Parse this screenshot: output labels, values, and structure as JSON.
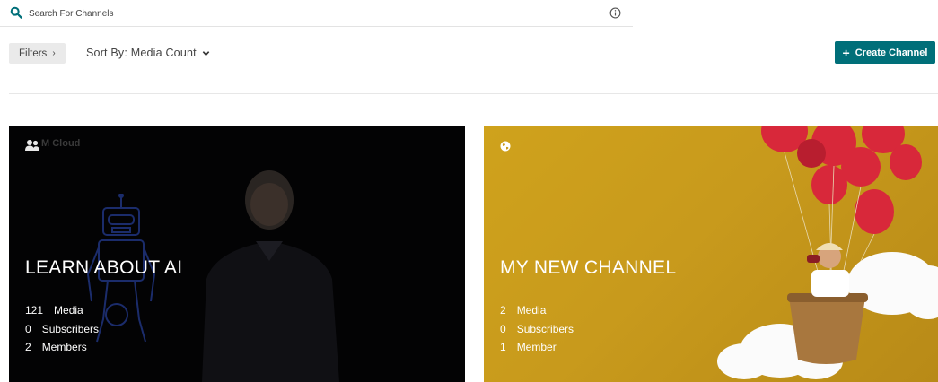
{
  "search": {
    "placeholder": "Search For Channels"
  },
  "toolbar": {
    "filters_label": "Filters",
    "sort_label": "Sort By: Media Count",
    "create_label": "Create Channel"
  },
  "colors": {
    "accent": "#006f79"
  },
  "channels": [
    {
      "title": "LEARN ABOUT AI",
      "owner_text": "M Cloud",
      "icon": "users-icon",
      "stats": [
        {
          "count": "121",
          "label": "Media"
        },
        {
          "count": "0",
          "label": "Subscribers"
        },
        {
          "count": "2",
          "label": "Members"
        }
      ]
    },
    {
      "title": "MY NEW CHANNEL",
      "icon": "globe-icon",
      "stats": [
        {
          "count": "2",
          "label": "Media"
        },
        {
          "count": "0",
          "label": "Subscribers"
        },
        {
          "count": "1",
          "label": "Member"
        }
      ]
    }
  ]
}
